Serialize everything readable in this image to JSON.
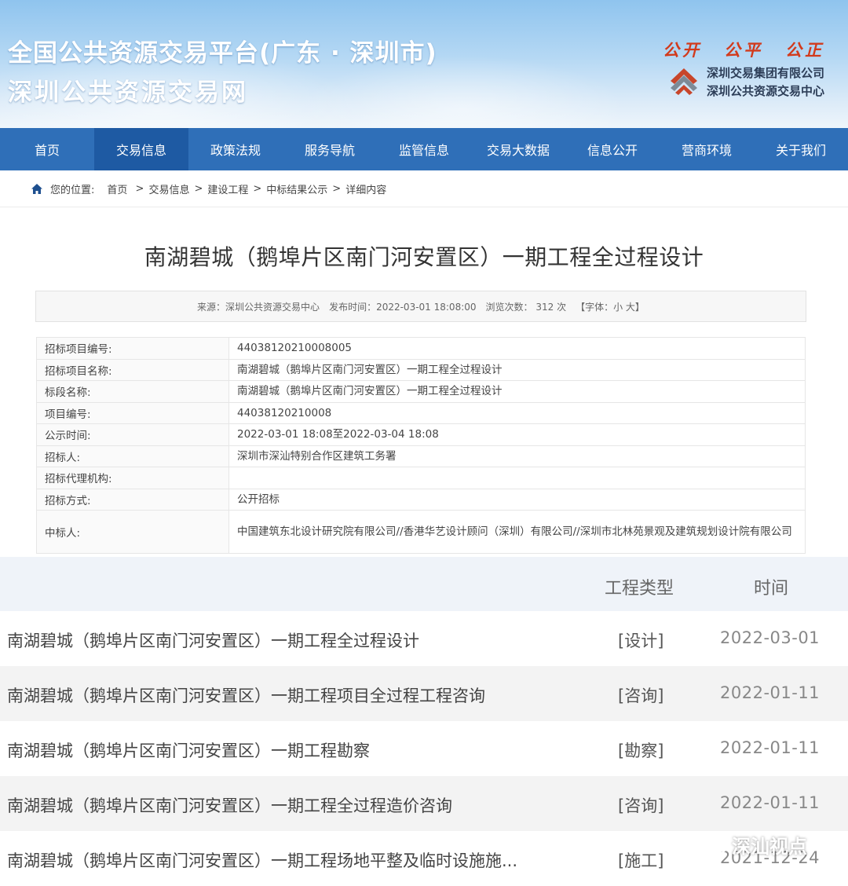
{
  "header": {
    "title_line1": "全国公共资源交易平台(广东 · 深圳市)",
    "title_line2": "深圳公共资源交易网",
    "slogan": [
      "公开",
      "公平",
      "公正"
    ],
    "org_name_1": "深圳交易集团有限公司",
    "org_name_2": "深圳公共资源交易中心"
  },
  "nav": {
    "items": [
      "首页",
      "交易信息",
      "政策法规",
      "服务导航",
      "监管信息",
      "交易大数据",
      "信息公开",
      "营商环境",
      "关于我们"
    ],
    "active_index": 1
  },
  "breadcrumb": {
    "label": "您的位置:",
    "items": [
      "首页",
      "交易信息",
      "建设工程",
      "中标结果公示",
      "详细内容"
    ]
  },
  "article": {
    "title": "南湖碧城（鹅埠片区南门河安置区）一期工程全过程设计",
    "meta": {
      "source": "来源：深圳公共资源交易中心",
      "published": "发布时间：2022-03-01 18:08:00",
      "views_label": "浏览次数：",
      "views": "312",
      "views_unit": "次",
      "font_size": "【字体：小 大】"
    },
    "fields": [
      {
        "key": "招标项目编号:",
        "value": "44038120210008005"
      },
      {
        "key": "招标项目名称:",
        "value": "南湖碧城（鹅埠片区南门河安置区）一期工程全过程设计"
      },
      {
        "key": "标段名称:",
        "value": "南湖碧城（鹅埠片区南门河安置区）一期工程全过程设计"
      },
      {
        "key": "项目编号:",
        "value": "44038120210008"
      },
      {
        "key": "公示时间:",
        "value": "2022-03-01 18:08至2022-03-04 18:08"
      },
      {
        "key": "招标人:",
        "value": "深圳市深汕特别合作区建筑工务署"
      },
      {
        "key": "招标代理机构:",
        "value": ""
      },
      {
        "key": "招标方式:",
        "value": "公开招标"
      },
      {
        "key": "中标人:",
        "value": "中国建筑东北设计研究院有限公司//香港华艺设计顾问（深圳）有限公司//深圳市北林苑景观及建筑规划设计院有限公司"
      }
    ]
  },
  "related": {
    "header_type": "工程类型",
    "header_time": "时间",
    "rows": [
      {
        "title": "南湖碧城（鹅埠片区南门河安置区）一期工程全过程设计",
        "type": "[设计]",
        "date": "2022-03-01"
      },
      {
        "title": "南湖碧城（鹅埠片区南门河安置区）一期工程项目全过程工程咨询",
        "type": "[咨询]",
        "date": "2022-01-11"
      },
      {
        "title": "南湖碧城（鹅埠片区南门河安置区）一期工程勘察",
        "type": "[勘察]",
        "date": "2022-01-11"
      },
      {
        "title": "南湖碧城（鹅埠片区南门河安置区）一期工程全过程造价咨询",
        "type": "[咨询]",
        "date": "2022-01-11"
      },
      {
        "title": "南湖碧城（鹅埠片区南门河安置区）一期工程场地平整及临时设施施...",
        "type": "[施工]",
        "date": "2021-12-24"
      }
    ]
  },
  "watermark": {
    "text": "深汕视点"
  },
  "colors": {
    "nav_bg": "#2f6fb8",
    "nav_active": "#1e5aa3",
    "slogan": "#d23a1c",
    "logo_red": "#c8452a"
  }
}
